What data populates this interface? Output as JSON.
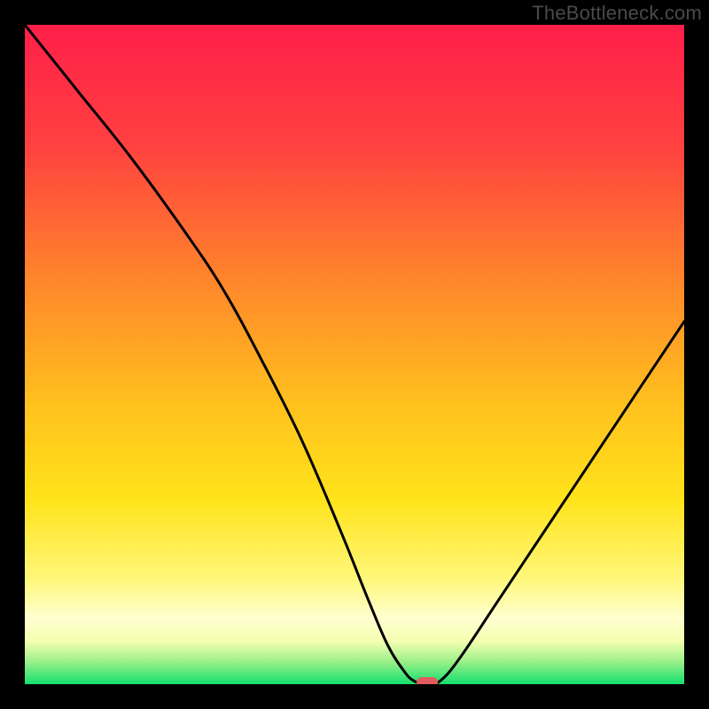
{
  "watermark": "TheBottleneck.com",
  "marker": {
    "position_pct": 61,
    "color": "#e35a5f"
  },
  "gradient_stops": [
    {
      "offset": 0.0,
      "color": "#ff1f4a"
    },
    {
      "offset": 0.18,
      "color": "#ff4040"
    },
    {
      "offset": 0.4,
      "color": "#ff8a2a"
    },
    {
      "offset": 0.58,
      "color": "#ffc21e"
    },
    {
      "offset": 0.72,
      "color": "#ffe31a"
    },
    {
      "offset": 0.84,
      "color": "#fff77a"
    },
    {
      "offset": 0.9,
      "color": "#ffffd0"
    },
    {
      "offset": 0.935,
      "color": "#f3ffb0"
    },
    {
      "offset": 0.965,
      "color": "#9ef08a"
    },
    {
      "offset": 1.0,
      "color": "#14e06f"
    }
  ],
  "chart_data": {
    "type": "line",
    "title": "",
    "xlabel": "",
    "ylabel": "",
    "xlim": [
      0,
      100
    ],
    "ylim": [
      0,
      100
    ],
    "legend": false,
    "grid": false,
    "series": [
      {
        "name": "bottleneck-curve",
        "x": [
          0,
          8,
          16,
          24,
          30,
          36,
          42,
          48,
          52,
          55,
          57.5,
          59,
          61,
          63,
          66,
          72,
          80,
          90,
          100
        ],
        "y": [
          100,
          90,
          80,
          69,
          60,
          49,
          37,
          23,
          13,
          6,
          2,
          0.5,
          0,
          0.5,
          4,
          13,
          25,
          40,
          55
        ]
      }
    ],
    "annotations": [
      {
        "kind": "marker",
        "x": 61,
        "y": 0,
        "shape": "pill",
        "color": "#e35a5f"
      }
    ]
  }
}
